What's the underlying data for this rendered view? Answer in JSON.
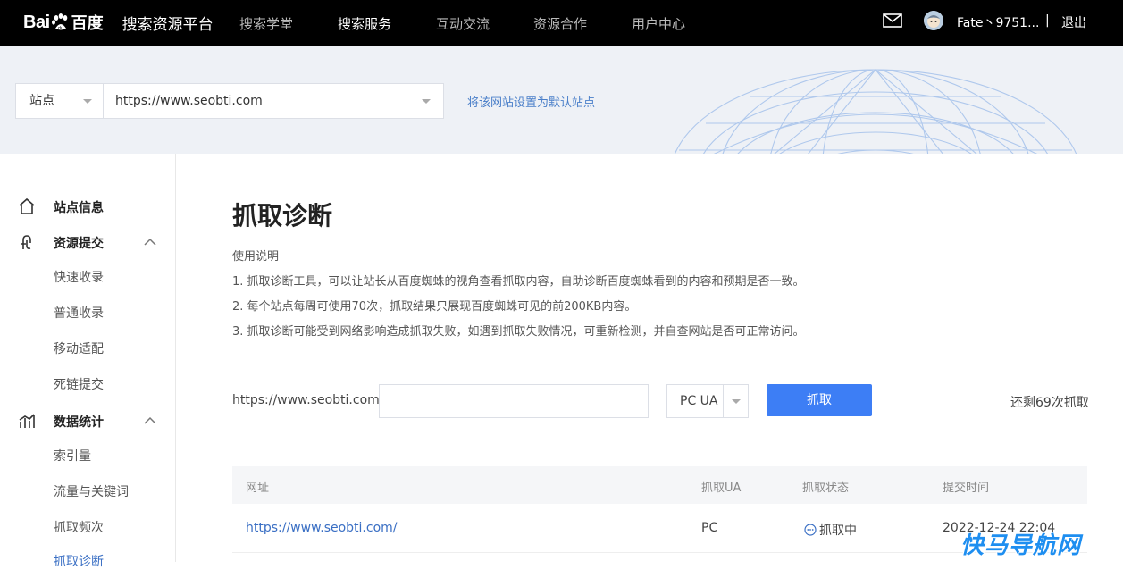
{
  "header": {
    "logo_bai": "Bai",
    "logo_du": "百度",
    "platform": "搜索资源平台",
    "nav": [
      {
        "label": "搜索学堂"
      },
      {
        "label": "搜索服务"
      },
      {
        "label": "互动交流"
      },
      {
        "label": "资源合作"
      },
      {
        "label": "用户中心"
      }
    ],
    "username": "Fate丶9751...",
    "separator": "|",
    "logout": "退出"
  },
  "banner": {
    "site_type": "站点",
    "site_url": "https://www.seobti.com",
    "set_default": "将该网站设置为默认站点"
  },
  "sidebar": {
    "site_info": "站点信息",
    "resource_submit": "资源提交",
    "resource_items": [
      "快速收录",
      "普通收录",
      "移动适配",
      "死链提交"
    ],
    "data_stats": "数据统计",
    "stats_items": [
      "索引量",
      "流量与关键词",
      "抓取频次",
      "抓取诊断"
    ]
  },
  "main": {
    "title": "抓取诊断",
    "desc_title": "使用说明",
    "desc": [
      "1. 抓取诊断工具，可以让站长从百度蜘蛛的视角查看抓取内容，自助诊断百度蜘蛛看到的内容和预期是否一致。",
      "2. 每个站点每周可使用70次，抓取结果只展现百度蜘蛛可见的前200KB内容。",
      "3. 抓取诊断可能受到网络影响造成抓取失败，如遇到抓取失败情况，可重新检测，并自查网站是否可正常访问。"
    ],
    "url_prefix": "https://www.seobti.com/",
    "path_value": "",
    "ua_value": "PC UA",
    "fetch_button": "抓取",
    "remaining": "还剩69次抓取"
  },
  "table": {
    "headers": {
      "url": "网址",
      "ua": "抓取UA",
      "status": "抓取状态",
      "time": "提交时间"
    },
    "rows": [
      {
        "url": "https://www.seobti.com/",
        "ua": "PC",
        "status": "抓取中",
        "time": "2022-12-24 22:04"
      }
    ]
  },
  "watermark": "快马导航网",
  "colors": {
    "primary": "#3d7ef5",
    "link": "#3a6fc4",
    "topbar": "#000000"
  }
}
